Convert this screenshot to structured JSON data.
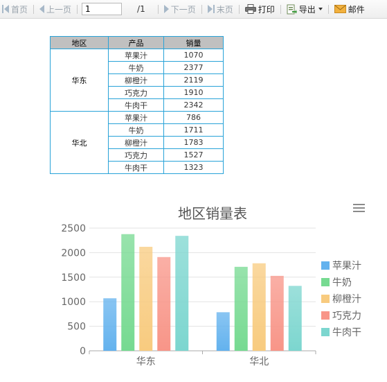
{
  "toolbar": {
    "first": "首页",
    "prev": "上一页",
    "page_value": "1",
    "page_total": "/1",
    "next": "下一页",
    "last": "末页",
    "print": "打印",
    "export": "导出",
    "mail": "邮件"
  },
  "table": {
    "headers": [
      "地区",
      "产品",
      "销量"
    ],
    "groups": [
      {
        "region": "华东",
        "rows": [
          {
            "product": "苹果汁",
            "sales": "1070"
          },
          {
            "product": "牛奶",
            "sales": "2377"
          },
          {
            "product": "柳橙汁",
            "sales": "2119"
          },
          {
            "product": "巧克力",
            "sales": "1910"
          },
          {
            "product": "牛肉干",
            "sales": "2342"
          }
        ]
      },
      {
        "region": "华北",
        "rows": [
          {
            "product": "苹果汁",
            "sales": "786"
          },
          {
            "product": "牛奶",
            "sales": "1711"
          },
          {
            "product": "柳橙汁",
            "sales": "1783"
          },
          {
            "product": "巧克力",
            "sales": "1527"
          },
          {
            "product": "牛肉干",
            "sales": "1323"
          }
        ]
      }
    ]
  },
  "chart_data": {
    "type": "bar",
    "title": "地区销量表",
    "categories": [
      "华东",
      "华北"
    ],
    "ylim": [
      0,
      2500
    ],
    "yticks": [
      0,
      500,
      1000,
      1500,
      2000,
      2500
    ],
    "grid": true,
    "legend_position": "right",
    "series": [
      {
        "name": "苹果汁",
        "values": [
          1070,
          786
        ],
        "color": "#63b2ee"
      },
      {
        "name": "牛奶",
        "values": [
          2377,
          1711
        ],
        "color": "#76da91"
      },
      {
        "name": "柳橙汁",
        "values": [
          2119,
          1783
        ],
        "color": "#f8cb7f"
      },
      {
        "name": "巧克力",
        "values": [
          1910,
          1527
        ],
        "color": "#f89588"
      },
      {
        "name": "牛肉干",
        "values": [
          2342,
          1323
        ],
        "color": "#7cd6cf"
      }
    ]
  },
  "icons": {
    "first": "first-page-icon",
    "prev": "prev-page-icon",
    "next": "next-page-icon",
    "last": "last-page-icon",
    "print": "printer-icon",
    "export": "export-icon",
    "mail": "mail-icon",
    "menu": "hamburger-menu-icon"
  }
}
